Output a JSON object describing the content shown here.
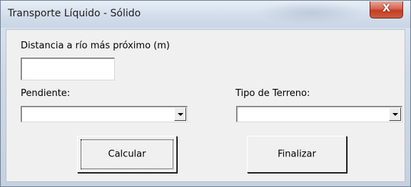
{
  "window": {
    "title": "Transporte Líquido - Sólido",
    "close_glyph": "X"
  },
  "form": {
    "distance_label": "Distancia a río más próximo (m)",
    "distance_value": "",
    "slope_label": "Pendiente:",
    "slope_value": "",
    "terrain_label": "Tipo de Terreno:",
    "terrain_value": ""
  },
  "buttons": {
    "calculate_label": "Calcular",
    "finish_label": "Finalizar"
  },
  "icons": {
    "close": "close-icon",
    "dropdown": "chevron-down-icon"
  },
  "colors": {
    "close_button": "#c23e25",
    "dialog_background": "#f0f0f0",
    "titlebar": "#d3deeb"
  }
}
